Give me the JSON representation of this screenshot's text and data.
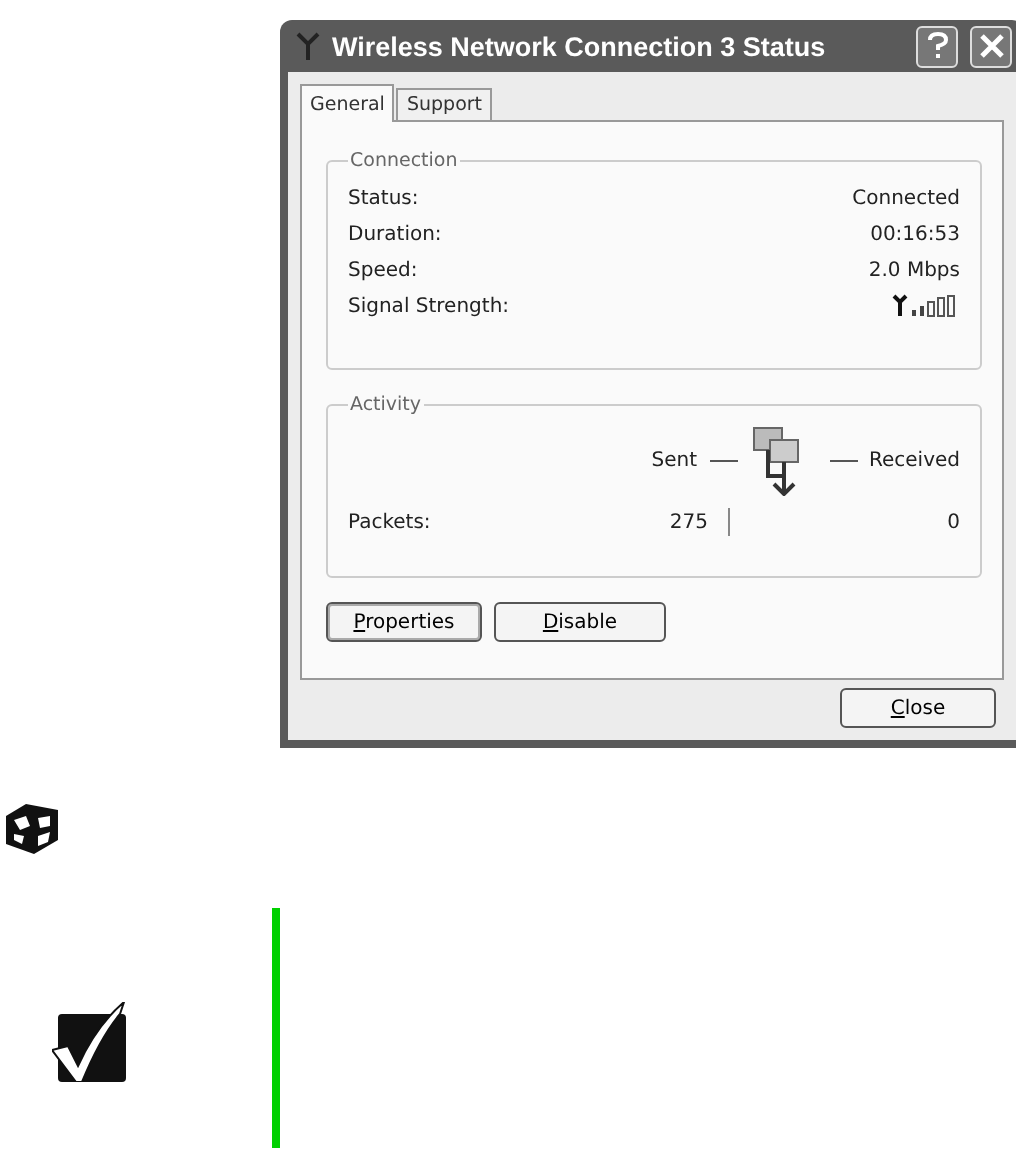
{
  "window": {
    "title": "Wireless Network Connection 3 Status"
  },
  "tabs": [
    {
      "label": "General",
      "selected": true
    },
    {
      "label": "Support",
      "selected": false
    }
  ],
  "connection": {
    "title": "Connection",
    "rows": [
      {
        "label": "Status:",
        "value": "Connected",
        "kind": "text"
      },
      {
        "label": "Duration:",
        "value": "00:16:53",
        "kind": "text"
      },
      {
        "label": "Speed:",
        "value": "2.0 Mbps",
        "kind": "text"
      },
      {
        "label": "Signal Strength:",
        "kind": "signal"
      }
    ]
  },
  "activity": {
    "title": "Activity",
    "sent_label": "Sent",
    "received_label": "Received",
    "packets_label": "Packets:",
    "packets_sent": "275",
    "packets_received": "0"
  },
  "panel_buttons": [
    "Properties",
    "Disable"
  ],
  "close_button": "Close"
}
